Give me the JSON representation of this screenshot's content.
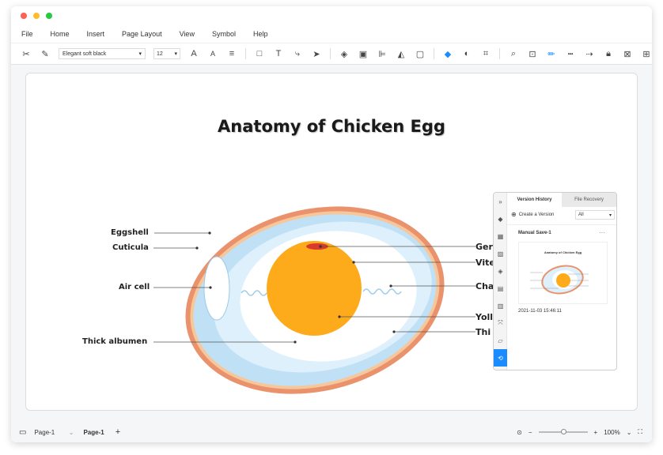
{
  "menu": [
    "File",
    "Home",
    "Insert",
    "Page Layout",
    "View",
    "Symbol",
    "Help"
  ],
  "toolbar": {
    "font": "Elegant soft black",
    "size": "12"
  },
  "diagram": {
    "title": "Anatomy of Chicken Egg",
    "left_labels": [
      "Eggshell",
      "Cuticula",
      "Air cell",
      "Thick albumen"
    ],
    "right_labels": [
      "Ger",
      "Vite",
      "Cha",
      "Yoll",
      "Thi"
    ]
  },
  "version_panel": {
    "tab_active": "Version History",
    "tab_inactive": "File Recovery",
    "create_label": "Create a Version",
    "filter": "All",
    "save_name": "Manual Save-1",
    "more": "···",
    "thumb_title": "Anatomy of Chicken Egg",
    "timestamp": "2021-11-03 15:46:11"
  },
  "status": {
    "page_select": "Page-1",
    "page_tab": "Page-1",
    "zoom": "100%"
  },
  "colors": {
    "accent": "#1a8cff",
    "shell": "#e9926b",
    "yolk": "#fdab1b"
  }
}
